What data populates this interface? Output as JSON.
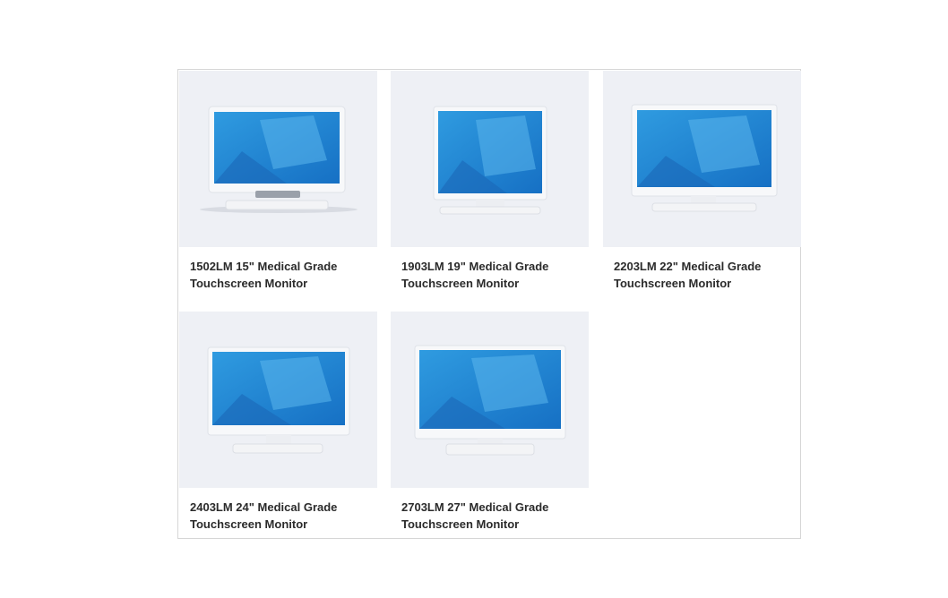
{
  "products": [
    {
      "title": "1502LM 15\" Medical Grade Touchscreen Monitor",
      "image": "monitor-15-icon"
    },
    {
      "title": "1903LM 19\" Medical Grade Touchscreen Monitor",
      "image": "monitor-19-icon"
    },
    {
      "title": "2203LM 22\" Medical Grade Touchscreen Monitor",
      "image": "monitor-22-icon"
    },
    {
      "title": "2403LM 24\" Medical Grade Touchscreen Monitor",
      "image": "monitor-24-icon"
    },
    {
      "title": "2703LM 27\" Medical Grade Touchscreen Monitor",
      "image": "monitor-27-icon"
    }
  ],
  "colors": {
    "thumb_bg": "#eef0f5",
    "screen_blue": "#1f8fd8",
    "screen_light": "#5bb7ec",
    "bezel": "#f7f8fa",
    "text": "#2b2b2b"
  }
}
